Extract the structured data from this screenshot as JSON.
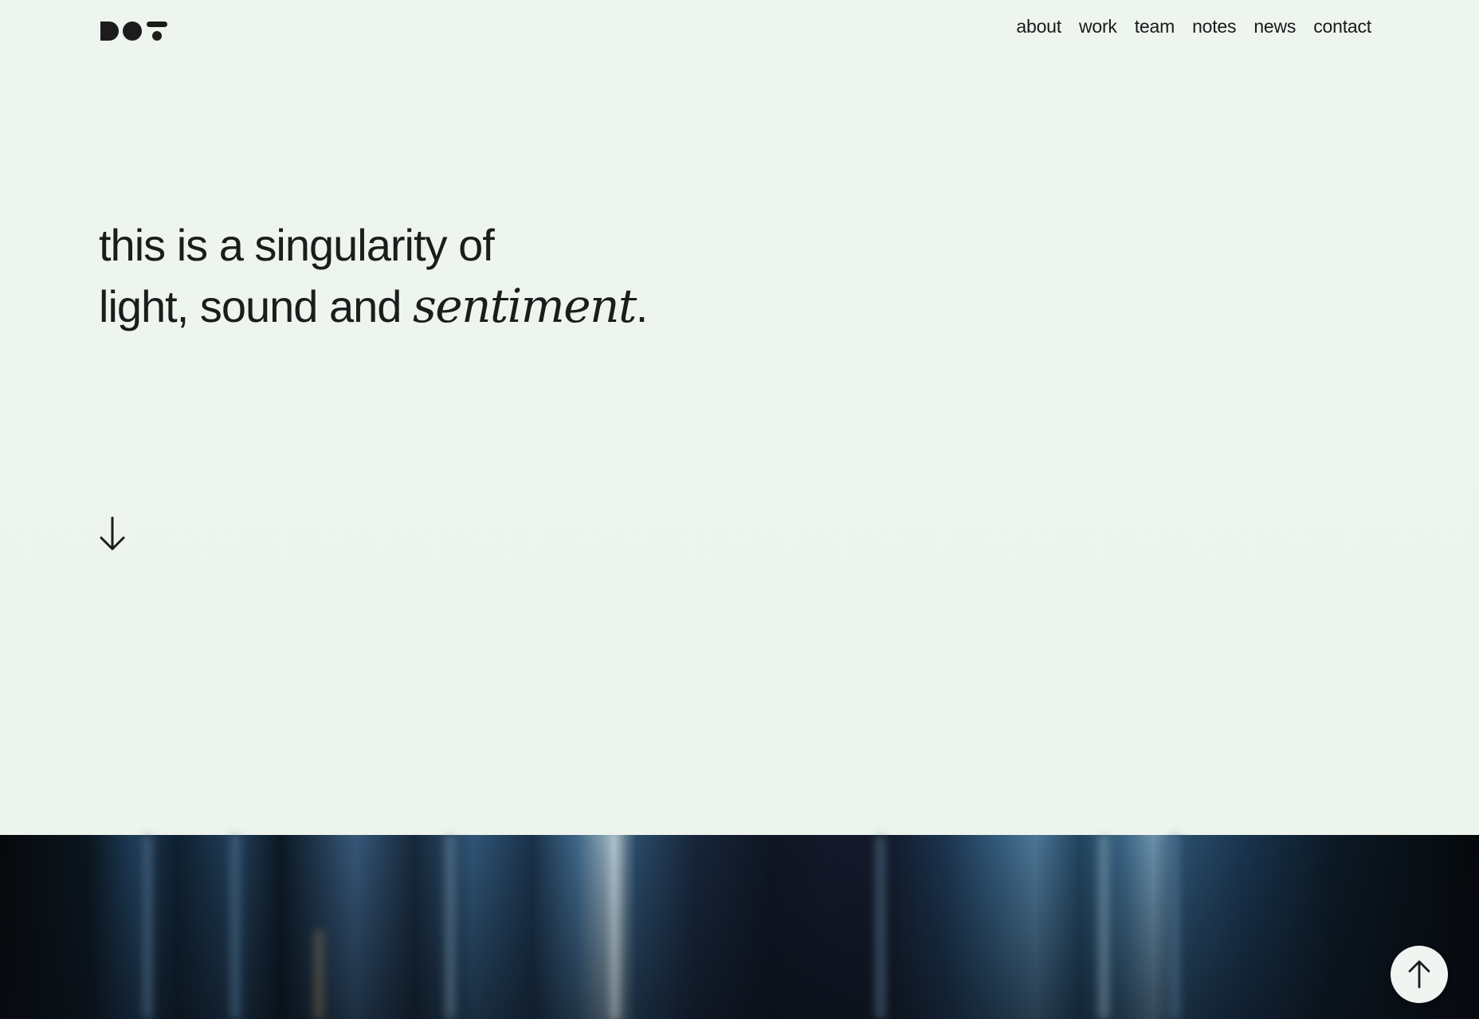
{
  "header": {
    "logo": "DOT",
    "nav": [
      {
        "label": "about"
      },
      {
        "label": "work"
      },
      {
        "label": "team"
      },
      {
        "label": "notes"
      },
      {
        "label": "news"
      },
      {
        "label": "contact"
      }
    ]
  },
  "hero": {
    "line1": "this is a singularity of",
    "line2_prefix": "light, sound and ",
    "line2_emphasis": "sentiment",
    "line2_suffix": "."
  },
  "icons": {
    "scroll": "arrow-down-icon",
    "back_to_top": "arrow-up-icon"
  },
  "colors": {
    "background": "#eef4ee",
    "text": "#1d1d1d",
    "dark_band": "#0b1620",
    "button_bg": "#f1f5f2"
  }
}
